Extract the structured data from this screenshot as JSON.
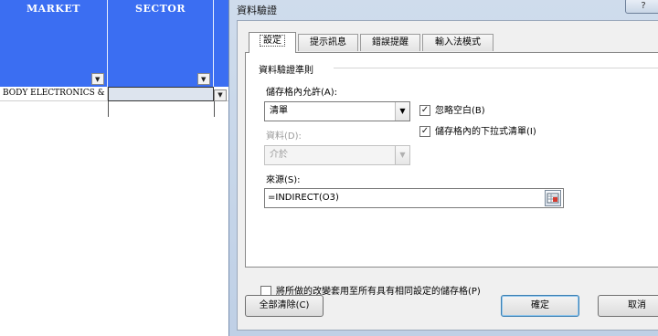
{
  "sheet": {
    "col_a_header": "MARKET",
    "col_b_header": "SECTOR",
    "cell_a2": "BODY ELECTRONICS &",
    "filter_icon": "▼"
  },
  "dialog": {
    "title": "資料驗證",
    "help": "?",
    "tabs": [
      "設定",
      "提示訊息",
      "錯誤提醒",
      "輸入法模式"
    ],
    "criteria_group": "資料驗證準則",
    "allow_label": "儲存格內允許(A):",
    "allow_value": "清單",
    "data_label": "資料(D):",
    "data_value": "介於",
    "ignore_blank": {
      "label": "忽略空白(B)",
      "checked": true
    },
    "in_cell_dropdown": {
      "label": "儲存格內的下拉式清單(I)",
      "checked": true
    },
    "source_label": "來源(S):",
    "source_value": "=INDIRECT(O3)",
    "apply_all": {
      "label": "將所做的改變套用至所有具有相同設定的儲存格(P)",
      "checked": false
    },
    "clear_all": "全部清除(C)",
    "ok": "確定",
    "cancel": "取消"
  },
  "colors": {
    "header_blue": "#3b6ef2",
    "dialog_frame": "#c6d6ea",
    "default_button_border": "#3c7fb1"
  }
}
